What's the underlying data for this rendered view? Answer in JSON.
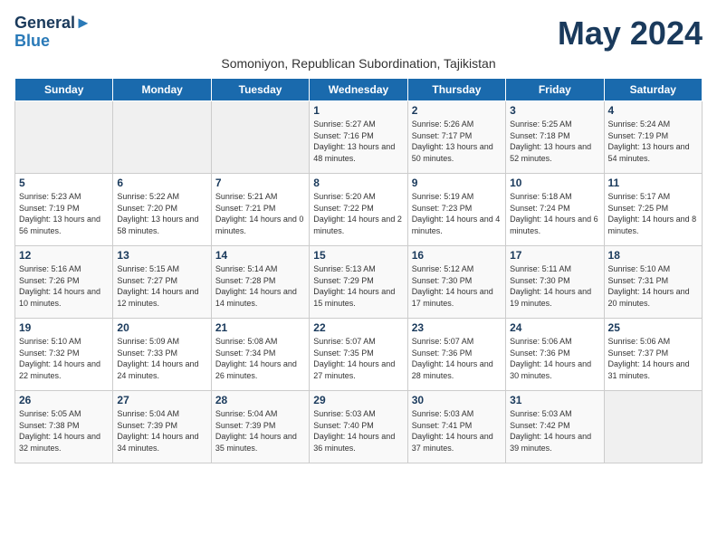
{
  "header": {
    "logo_line1": "General",
    "logo_line2": "Blue",
    "month_title": "May 2024",
    "subtitle": "Somoniyon, Republican Subordination, Tajikistan"
  },
  "weekdays": [
    "Sunday",
    "Monday",
    "Tuesday",
    "Wednesday",
    "Thursday",
    "Friday",
    "Saturday"
  ],
  "weeks": [
    [
      {
        "day": "",
        "info": ""
      },
      {
        "day": "",
        "info": ""
      },
      {
        "day": "",
        "info": ""
      },
      {
        "day": "1",
        "info": "Sunrise: 5:27 AM\nSunset: 7:16 PM\nDaylight: 13 hours and 48 minutes."
      },
      {
        "day": "2",
        "info": "Sunrise: 5:26 AM\nSunset: 7:17 PM\nDaylight: 13 hours and 50 minutes."
      },
      {
        "day": "3",
        "info": "Sunrise: 5:25 AM\nSunset: 7:18 PM\nDaylight: 13 hours and 52 minutes."
      },
      {
        "day": "4",
        "info": "Sunrise: 5:24 AM\nSunset: 7:19 PM\nDaylight: 13 hours and 54 minutes."
      }
    ],
    [
      {
        "day": "5",
        "info": "Sunrise: 5:23 AM\nSunset: 7:19 PM\nDaylight: 13 hours and 56 minutes."
      },
      {
        "day": "6",
        "info": "Sunrise: 5:22 AM\nSunset: 7:20 PM\nDaylight: 13 hours and 58 minutes."
      },
      {
        "day": "7",
        "info": "Sunrise: 5:21 AM\nSunset: 7:21 PM\nDaylight: 14 hours and 0 minutes."
      },
      {
        "day": "8",
        "info": "Sunrise: 5:20 AM\nSunset: 7:22 PM\nDaylight: 14 hours and 2 minutes."
      },
      {
        "day": "9",
        "info": "Sunrise: 5:19 AM\nSunset: 7:23 PM\nDaylight: 14 hours and 4 minutes."
      },
      {
        "day": "10",
        "info": "Sunrise: 5:18 AM\nSunset: 7:24 PM\nDaylight: 14 hours and 6 minutes."
      },
      {
        "day": "11",
        "info": "Sunrise: 5:17 AM\nSunset: 7:25 PM\nDaylight: 14 hours and 8 minutes."
      }
    ],
    [
      {
        "day": "12",
        "info": "Sunrise: 5:16 AM\nSunset: 7:26 PM\nDaylight: 14 hours and 10 minutes."
      },
      {
        "day": "13",
        "info": "Sunrise: 5:15 AM\nSunset: 7:27 PM\nDaylight: 14 hours and 12 minutes."
      },
      {
        "day": "14",
        "info": "Sunrise: 5:14 AM\nSunset: 7:28 PM\nDaylight: 14 hours and 14 minutes."
      },
      {
        "day": "15",
        "info": "Sunrise: 5:13 AM\nSunset: 7:29 PM\nDaylight: 14 hours and 15 minutes."
      },
      {
        "day": "16",
        "info": "Sunrise: 5:12 AM\nSunset: 7:30 PM\nDaylight: 14 hours and 17 minutes."
      },
      {
        "day": "17",
        "info": "Sunrise: 5:11 AM\nSunset: 7:30 PM\nDaylight: 14 hours and 19 minutes."
      },
      {
        "day": "18",
        "info": "Sunrise: 5:10 AM\nSunset: 7:31 PM\nDaylight: 14 hours and 20 minutes."
      }
    ],
    [
      {
        "day": "19",
        "info": "Sunrise: 5:10 AM\nSunset: 7:32 PM\nDaylight: 14 hours and 22 minutes."
      },
      {
        "day": "20",
        "info": "Sunrise: 5:09 AM\nSunset: 7:33 PM\nDaylight: 14 hours and 24 minutes."
      },
      {
        "day": "21",
        "info": "Sunrise: 5:08 AM\nSunset: 7:34 PM\nDaylight: 14 hours and 26 minutes."
      },
      {
        "day": "22",
        "info": "Sunrise: 5:07 AM\nSunset: 7:35 PM\nDaylight: 14 hours and 27 minutes."
      },
      {
        "day": "23",
        "info": "Sunrise: 5:07 AM\nSunset: 7:36 PM\nDaylight: 14 hours and 28 minutes."
      },
      {
        "day": "24",
        "info": "Sunrise: 5:06 AM\nSunset: 7:36 PM\nDaylight: 14 hours and 30 minutes."
      },
      {
        "day": "25",
        "info": "Sunrise: 5:06 AM\nSunset: 7:37 PM\nDaylight: 14 hours and 31 minutes."
      }
    ],
    [
      {
        "day": "26",
        "info": "Sunrise: 5:05 AM\nSunset: 7:38 PM\nDaylight: 14 hours and 32 minutes."
      },
      {
        "day": "27",
        "info": "Sunrise: 5:04 AM\nSunset: 7:39 PM\nDaylight: 14 hours and 34 minutes."
      },
      {
        "day": "28",
        "info": "Sunrise: 5:04 AM\nSunset: 7:39 PM\nDaylight: 14 hours and 35 minutes."
      },
      {
        "day": "29",
        "info": "Sunrise: 5:03 AM\nSunset: 7:40 PM\nDaylight: 14 hours and 36 minutes."
      },
      {
        "day": "30",
        "info": "Sunrise: 5:03 AM\nSunset: 7:41 PM\nDaylight: 14 hours and 37 minutes."
      },
      {
        "day": "31",
        "info": "Sunrise: 5:03 AM\nSunset: 7:42 PM\nDaylight: 14 hours and 39 minutes."
      },
      {
        "day": "",
        "info": ""
      }
    ]
  ]
}
